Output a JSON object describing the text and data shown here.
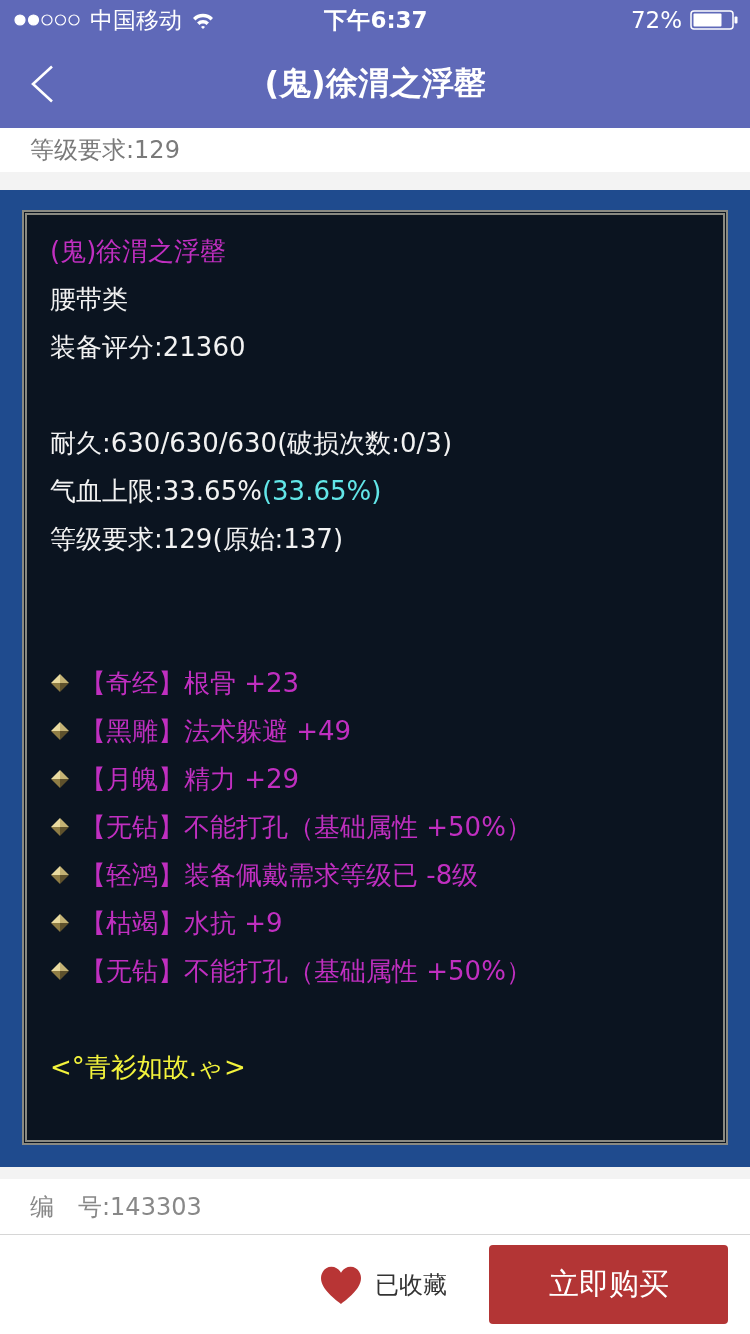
{
  "status_bar": {
    "carrier": "中国移动",
    "time": "下午6:37",
    "battery": "72%"
  },
  "nav": {
    "title": "(鬼)徐渭之浮罄"
  },
  "summary": "等级要求:129",
  "item_card": {
    "lines": [
      {
        "kind": "name",
        "text": "(鬼)徐渭之浮罄"
      },
      {
        "kind": "plain",
        "text": "腰带类"
      },
      {
        "kind": "plain",
        "text": "装备评分:21360"
      },
      {
        "kind": "spacer"
      },
      {
        "kind": "plain",
        "text": "耐久:630/630/630(破损次数:0/3)"
      },
      {
        "kind": "stat",
        "text": "气血上限:33.65%",
        "bonus": "(33.65%)"
      },
      {
        "kind": "plain",
        "text": "等级要求:129(原始:137)"
      },
      {
        "kind": "spacer"
      },
      {
        "kind": "spacer"
      },
      {
        "kind": "effect",
        "text": "【奇经】根骨 +23"
      },
      {
        "kind": "effect",
        "text": "【黑雕】法术躲避 +49"
      },
      {
        "kind": "effect",
        "text": "【月魄】精力 +29"
      },
      {
        "kind": "effect",
        "text": "【无钻】不能打孔（基础属性 +50%）"
      },
      {
        "kind": "effect",
        "text": "【轻鸿】装备佩戴需求等级已 -8级"
      },
      {
        "kind": "effect",
        "text": "【枯竭】水抗 +9"
      },
      {
        "kind": "effect",
        "text": "【无钻】不能打孔（基础属性 +50%）"
      },
      {
        "kind": "spacer"
      },
      {
        "kind": "signature",
        "text": "<°青衫如故.ゃ>"
      }
    ]
  },
  "serial": "编　号:143303",
  "bottom_bar": {
    "favorite": {
      "label": "已收藏",
      "on": true
    },
    "buy": {
      "label": "立即购买"
    }
  }
}
